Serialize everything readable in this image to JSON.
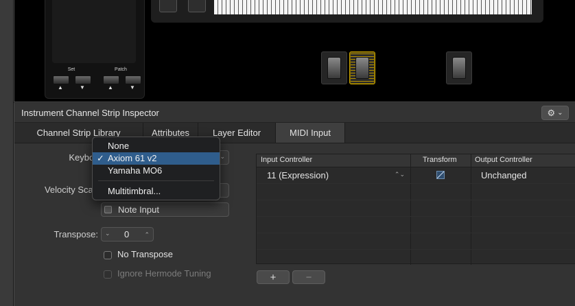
{
  "instrument": {
    "panel_set_label": "Set",
    "panel_patch_label": "Patch",
    "arrow_up": "▲",
    "arrow_down": "▼"
  },
  "inspector": {
    "title": "Instrument Channel Strip Inspector",
    "gear_chevron": "⌄",
    "tabs": [
      {
        "label": "Channel Strip Library",
        "active": false
      },
      {
        "label": "Attributes",
        "active": false
      },
      {
        "label": "Layer Editor",
        "active": false
      },
      {
        "label": "MIDI Input",
        "active": true
      }
    ]
  },
  "midi_input": {
    "keyboard_label": "Keyboard",
    "velocity_label": "Velocity Scaling",
    "note_input_label": "Note Input",
    "transpose_label": "Transpose:",
    "transpose_value": "0",
    "no_transpose_label": "No Transpose",
    "ignore_hermode_label": "Ignore Hermode Tuning",
    "table": {
      "headers": [
        "Input Controller",
        "Transform",
        "Output Controller"
      ],
      "rows": [
        {
          "input": "11 (Expression)",
          "output": "Unchanged"
        }
      ]
    },
    "add_label": "+",
    "remove_label": "−"
  },
  "keyboard_menu": {
    "items": [
      {
        "label": "None",
        "checked": false
      },
      {
        "label": "Axiom 61 v2",
        "checked": true
      },
      {
        "label": "Yamaha MO6",
        "checked": false
      },
      {
        "label": "Multitimbral...",
        "checked": false
      }
    ],
    "check_glyph": "✓"
  },
  "colors": {
    "accent_selection": "#2f5d8c",
    "selected_pedal": "#c9a400"
  }
}
